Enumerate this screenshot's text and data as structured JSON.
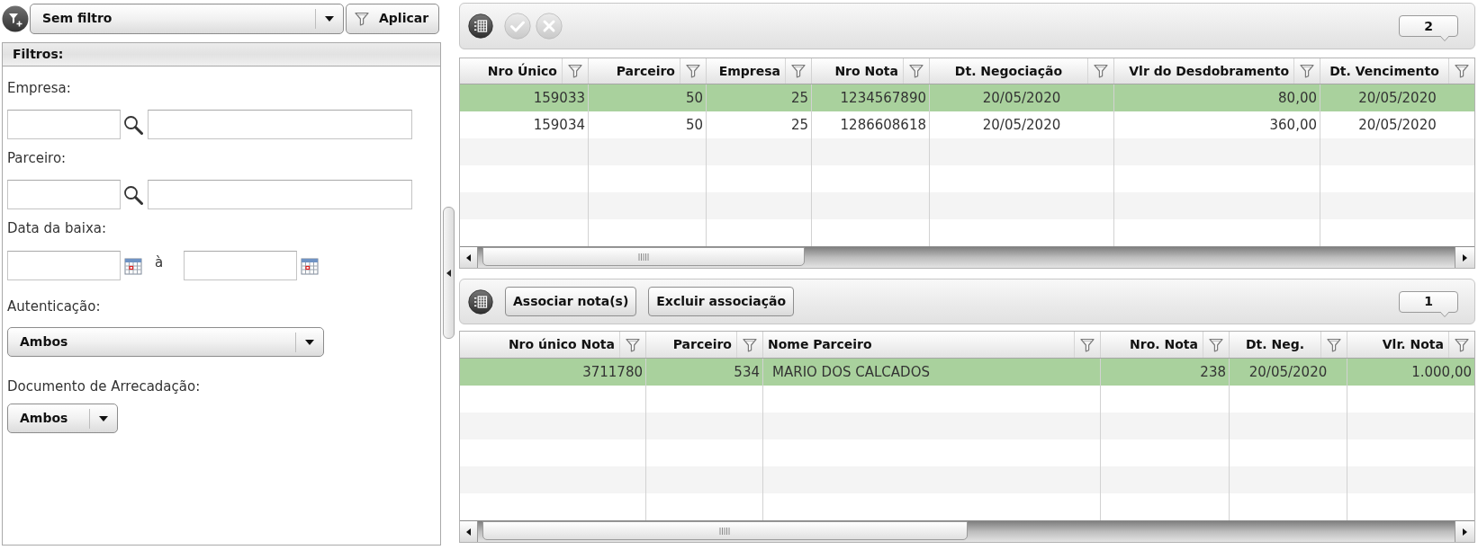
{
  "filter_bar": {
    "preset_select": {
      "value": "Sem filtro"
    },
    "apply_button": "Aplicar"
  },
  "filters_panel": {
    "title": "Filtros:",
    "fields": [
      {
        "kind": "lookup",
        "label": "Empresa:"
      },
      {
        "kind": "lookup",
        "label": "Parceiro:"
      },
      {
        "kind": "date_range",
        "label": "Data da baixa:",
        "separator": "à"
      },
      {
        "kind": "select",
        "label": "Autenticação:",
        "value": "Ambos"
      },
      {
        "kind": "select",
        "label": "Documento de Arrecadação:",
        "value": "Ambos"
      }
    ]
  },
  "upper_panel": {
    "toolbar": {
      "actions": [
        {
          "kind": "grid",
          "disabled": false
        },
        {
          "kind": "confirm",
          "disabled": true
        },
        {
          "kind": "cancel",
          "disabled": true
        }
      ],
      "count": "2"
    },
    "table": {
      "columns": [
        {
          "label": "Nro Único",
          "kind": "number"
        },
        {
          "label": "Parceiro",
          "kind": "number"
        },
        {
          "label": "Empresa",
          "kind": "number"
        },
        {
          "label": "Nro Nota",
          "kind": "number"
        },
        {
          "label": "Dt. Negociação",
          "kind": "date"
        },
        {
          "label": "Vlr do Desdobramento",
          "kind": "number"
        },
        {
          "label": "Dt. Vencimento",
          "kind": "date"
        }
      ],
      "rows": [
        {
          "selected": true,
          "cells": [
            "159033",
            "50",
            "25",
            "1234567890",
            "20/05/2020",
            "80,00",
            "20/05/2020"
          ]
        },
        {
          "selected": false,
          "cells": [
            "159034",
            "50",
            "25",
            "1286608618",
            "20/05/2020",
            "360,00",
            "20/05/2020"
          ]
        }
      ]
    }
  },
  "lower_panel": {
    "toolbar": {
      "actions": [
        {
          "kind": "grid",
          "disabled": false
        },
        {
          "kind": "button",
          "label": "Associar nota(s)",
          "disabled": false
        },
        {
          "kind": "button",
          "label": "Excluir associação",
          "disabled": false
        }
      ],
      "count": "1"
    },
    "table": {
      "columns": [
        {
          "label": "Nro único Nota",
          "kind": "number"
        },
        {
          "label": "Parceiro",
          "kind": "number"
        },
        {
          "label": "Nome Parceiro",
          "kind": "text"
        },
        {
          "label": "Nro. Nota",
          "kind": "number"
        },
        {
          "label": "Dt. Neg.",
          "kind": "date"
        },
        {
          "label": "Vlr. Nota",
          "kind": "number"
        }
      ],
      "rows": [
        {
          "selected": true,
          "cells": [
            "3711780",
            "534",
            "MARIO DOS CALCADOS",
            "238",
            "20/05/2020",
            "1.000,00"
          ]
        }
      ]
    }
  }
}
